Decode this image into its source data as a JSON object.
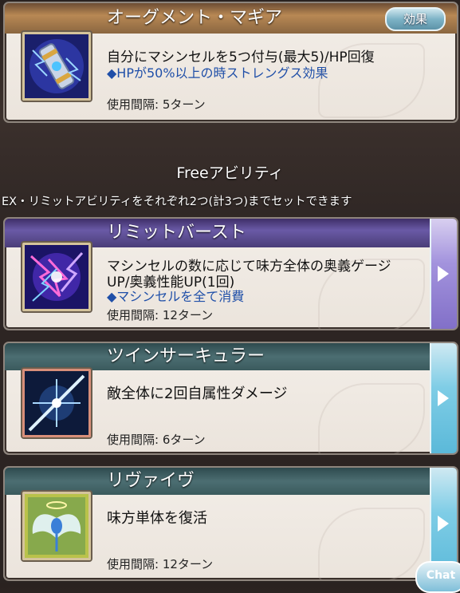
{
  "top_skill": {
    "name": "オーグメント・マギア",
    "badge": "効果",
    "description": "自分にマシンセルを5つ付与(最大5)/HP回復",
    "note": "◆HPが50%以上の時ストレングス効果",
    "cooldown": "使用間隔: 5ターン",
    "icon": "magic-cylinder-icon"
  },
  "free_section": {
    "title": "Freeアビリティ",
    "subtitle": "EX・リミットアビリティをそれぞれ2つ(計3つ)までセットできます"
  },
  "abilities": [
    {
      "name": "リミットバースト",
      "description_line1": "マシンセルの数に応じて味方全体の奥義ゲージ",
      "description_line2": "UP/奥義性能UP(1回)",
      "note": "◆マシンセルを全て消費",
      "cooldown": "使用間隔: 12ターン",
      "icon": "lightning-burst-icon",
      "header_color": "#5a4a90"
    },
    {
      "name": "ツインサーキュラー",
      "description": "敵全体に2回自属性ダメージ",
      "cooldown": "使用間隔: 6ターン",
      "icon": "light-slash-icon",
      "header_color": "#3f5e62"
    },
    {
      "name": "リヴァイヴ",
      "description": "味方単体を復活",
      "cooldown": "使用間隔: 12ターン",
      "icon": "angel-revive-icon",
      "header_color": "#3f5e62"
    }
  ],
  "chat_button": "Chat"
}
